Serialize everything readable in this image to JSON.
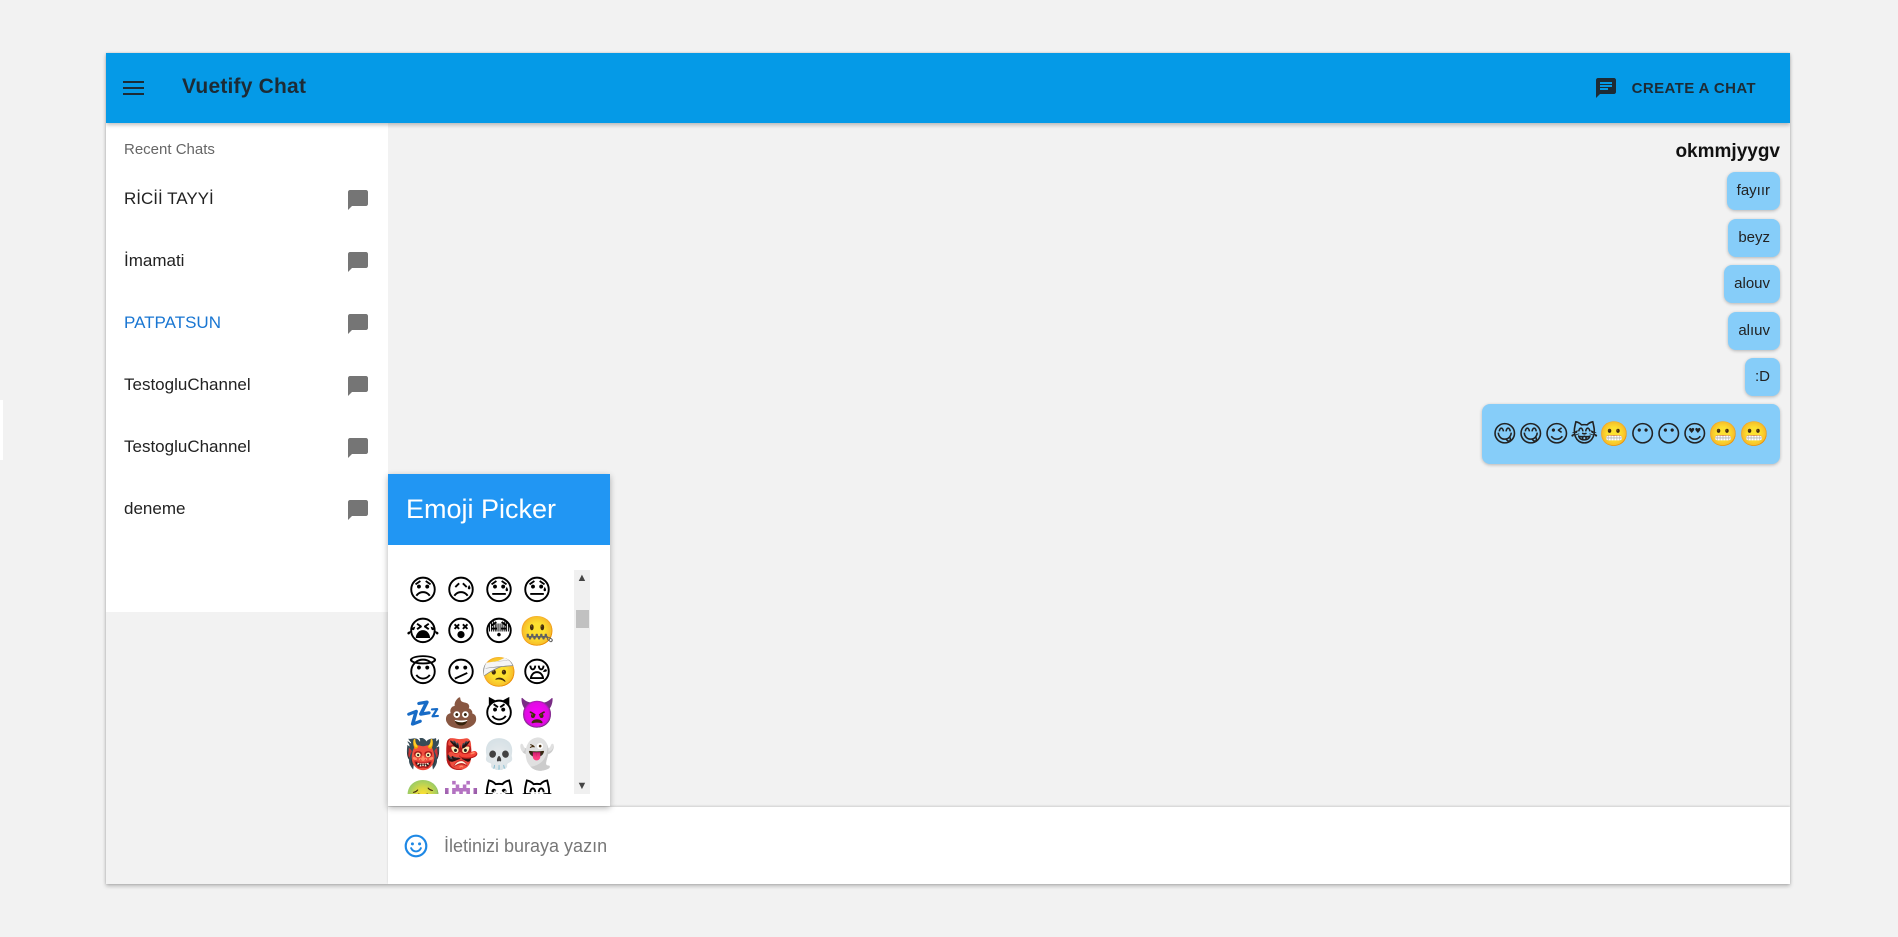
{
  "toolbar": {
    "title": "Vuetify Chat",
    "create_label": "CREATE A CHAT"
  },
  "sidebar": {
    "subheader": "Recent Chats",
    "items": [
      {
        "label": "RİCİİ TAYYİ"
      },
      {
        "label": "İmamati"
      },
      {
        "label": "PATPATSUN"
      },
      {
        "label": "TestogluChannel"
      },
      {
        "label": "TestogluChannel"
      },
      {
        "label": "deneme"
      }
    ],
    "active_index": 2
  },
  "conversation": {
    "sender": "okmmjyygv",
    "messages": [
      {
        "text": "fayıır"
      },
      {
        "text": "beyz"
      },
      {
        "text": "alouv"
      },
      {
        "text": "alıuv"
      },
      {
        "text": ":D"
      },
      {
        "text": "😋😋😉😹😬😶😶😍😬😬"
      }
    ]
  },
  "emoji_picker": {
    "title": "Emoji Picker",
    "emojis": [
      "😞",
      "😥",
      "😓",
      "😓",
      "😭",
      "😵",
      "😳",
      "🤐",
      "😇",
      "😕",
      "🤕",
      "😪",
      "💤",
      "💩",
      "😈",
      "👿",
      "👹",
      "👺",
      "💀",
      "👻",
      "🤢",
      "👾",
      "😺",
      "😸"
    ]
  },
  "composer": {
    "placeholder": "İletinizi buraya yazın",
    "value": ""
  },
  "colors": {
    "toolbar": "#059ae7",
    "bubble": "#86cdf9",
    "picker_header": "#2196f3",
    "active_chat": "#1976d2"
  }
}
